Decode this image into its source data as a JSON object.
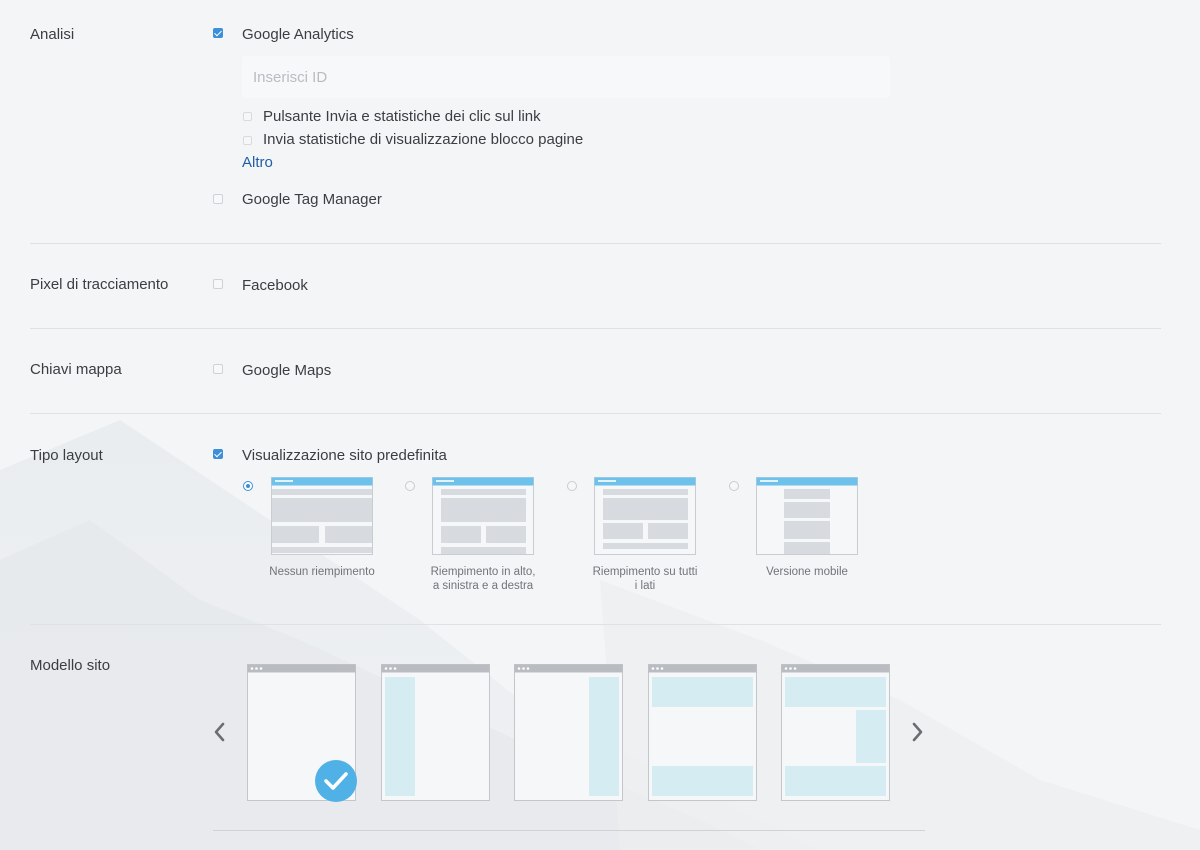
{
  "sections": {
    "analytics": {
      "label": "Analisi",
      "google_analytics": {
        "label": "Google Analytics",
        "checked": true
      },
      "id_input": {
        "placeholder": "Inserisci ID",
        "value": ""
      },
      "sub_options": [
        {
          "label": "Pulsante Invia e statistiche dei clic sul link",
          "checked": false
        },
        {
          "label": "Invia statistiche di visualizzazione blocco pagine",
          "checked": false
        }
      ],
      "more_link": "Altro",
      "google_tag_manager": {
        "label": "Google Tag Manager",
        "checked": false
      }
    },
    "tracking_pixel": {
      "label": "Pixel di tracciamento",
      "facebook": {
        "label": "Facebook",
        "checked": false
      }
    },
    "map_keys": {
      "label": "Chiavi mappa",
      "google_maps": {
        "label": "Google Maps",
        "checked": false
      }
    },
    "layout_type": {
      "label": "Tipo layout",
      "default_view": {
        "label": "Visualizzazione sito predefinita",
        "checked": true
      },
      "options": [
        {
          "caption": "Nessun riempimento",
          "selected": true
        },
        {
          "caption": "Riempimento in alto, a sinistra e a destra",
          "selected": false
        },
        {
          "caption": "Riempimento su tutti i lati",
          "selected": false
        },
        {
          "caption": "Versione mobile",
          "selected": false
        }
      ]
    },
    "site_template": {
      "label": "Modello sito",
      "selected_index": 0,
      "templates": [
        "blank",
        "left-sidebar",
        "right-sidebar",
        "header-footer",
        "header-right-footer"
      ]
    }
  },
  "colors": {
    "accent": "#3d8fd8",
    "thumb_header_blue": "#6ec1ea",
    "template_block": "#d6ecf3",
    "selected_frame": "#4fb1e5",
    "link": "#1f5fa6"
  }
}
